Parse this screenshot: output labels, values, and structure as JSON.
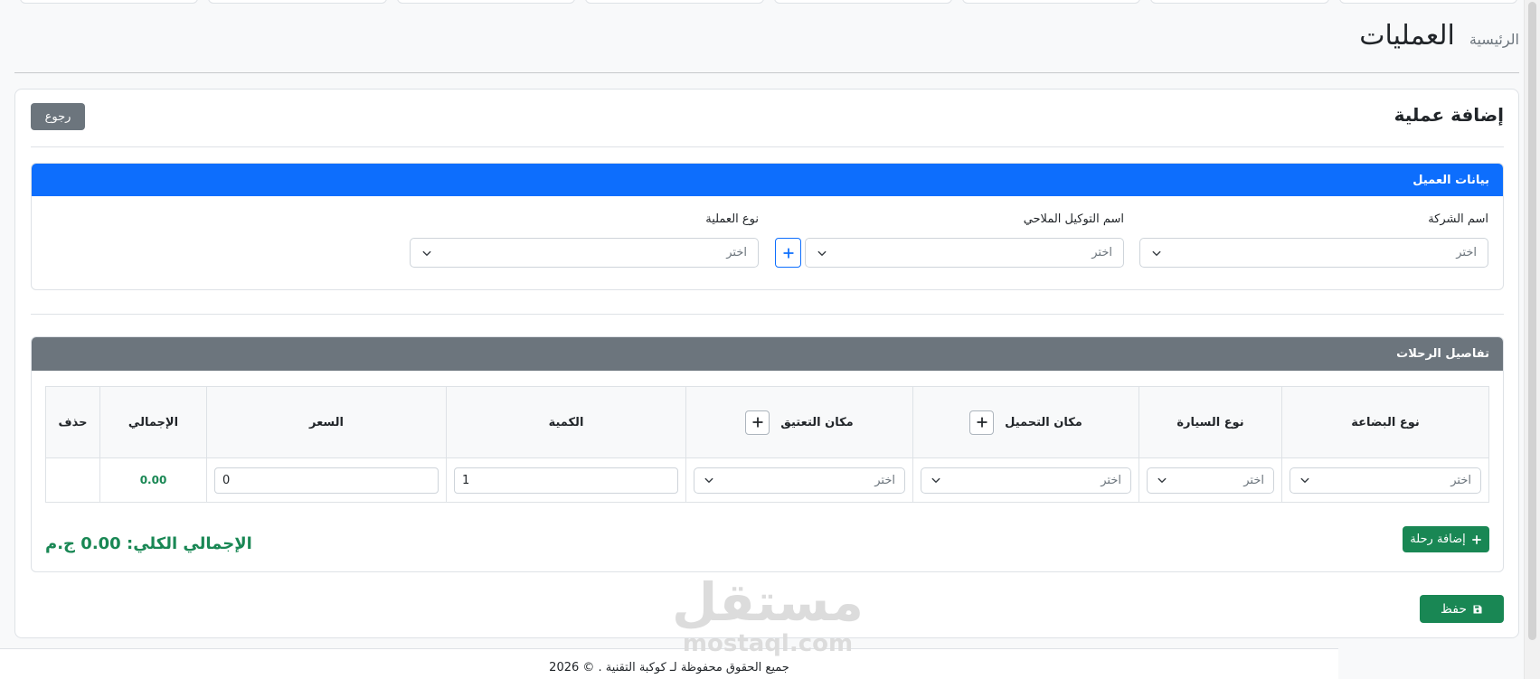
{
  "header": {
    "breadcrumb_home": "الرئيسية",
    "title": "العمليات"
  },
  "card": {
    "title": "إضافة عملية",
    "back_label": "رجوع"
  },
  "client_panel": {
    "title": "بيانات العميل",
    "fields": [
      {
        "label": "اسم الشركة",
        "placeholder": "اختر"
      },
      {
        "label": "اسم التوكيل الملاحي",
        "placeholder": "اختر"
      },
      {
        "label": "نوع العملية",
        "placeholder": "اختر"
      }
    ]
  },
  "trips_panel": {
    "title": "تفاصيل الرحلات",
    "columns": [
      "نوع البضاعة",
      "نوع السيارة",
      "مكان التحميل",
      "مكان التعتيق",
      "الكمية",
      "السعر",
      "الإجمالي",
      "حذف"
    ],
    "rows": [
      {
        "goods_type": "اختر",
        "vehicle_type": "اختر",
        "loading_place": "اختر",
        "unloading_place": "اختر",
        "quantity": "1",
        "price": "0",
        "total": "0.00"
      }
    ],
    "add_trip_label": "إضافة رحلة",
    "grand_total": {
      "label": "الإجمالي الكلي:",
      "value": "0.00",
      "currency": "ج.م"
    }
  },
  "save_label": "حفظ",
  "footer": {
    "text": "جميع الحقوق محفوظة لـ كوكبة التقنية . © 2026"
  },
  "watermark": {
    "logo": "مستقل",
    "site": "mostaql.com"
  },
  "icons": {
    "dropdown": "chevron-down-icon",
    "add": "plus-icon",
    "save": "floppy-disk-icon"
  },
  "colors": {
    "primary": "#0d6efd",
    "secondary": "#6c757d",
    "success": "#198754",
    "page_background": "#f8f9fa",
    "border": "#dee2e6"
  }
}
